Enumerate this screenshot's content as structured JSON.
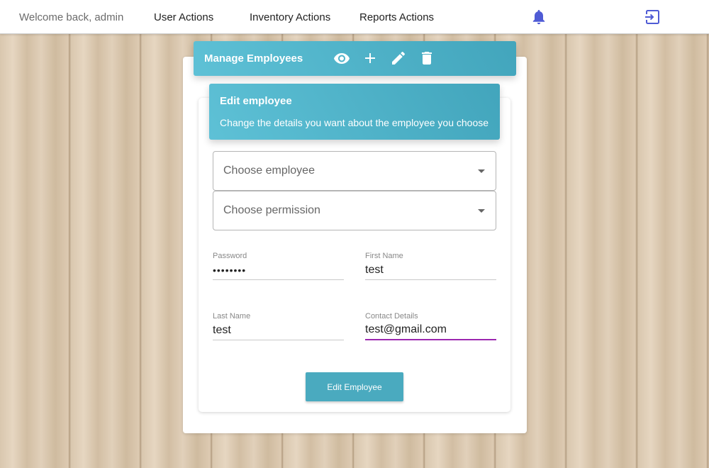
{
  "navbar": {
    "welcome": "Welcome back, admin",
    "links": [
      "User Actions",
      "Inventory Actions",
      "Reports Actions"
    ],
    "bell_icon": "bell-icon",
    "logout_icon": "logout-icon",
    "icon_color": "#4f5bd5"
  },
  "manage": {
    "title": "Manage Employees",
    "icons": [
      "eye-icon",
      "plus-icon",
      "pencil-icon",
      "trash-icon"
    ]
  },
  "edit_card": {
    "title": "Edit employee",
    "subtitle": "Change the details you want about the employee you choose"
  },
  "form": {
    "employee_select": "Choose employee",
    "permission_select": "Choose permission",
    "password": {
      "label": "Password",
      "value": "••••••••"
    },
    "first_name": {
      "label": "First Name",
      "value": "test"
    },
    "last_name": {
      "label": "Last Name",
      "value": "test"
    },
    "contact": {
      "label": "Contact Details",
      "value": "test@gmail.com"
    },
    "submit": "Edit Employee"
  },
  "colors": {
    "header_accent": "#4aaabf",
    "active_underline": "#9c27b0"
  }
}
